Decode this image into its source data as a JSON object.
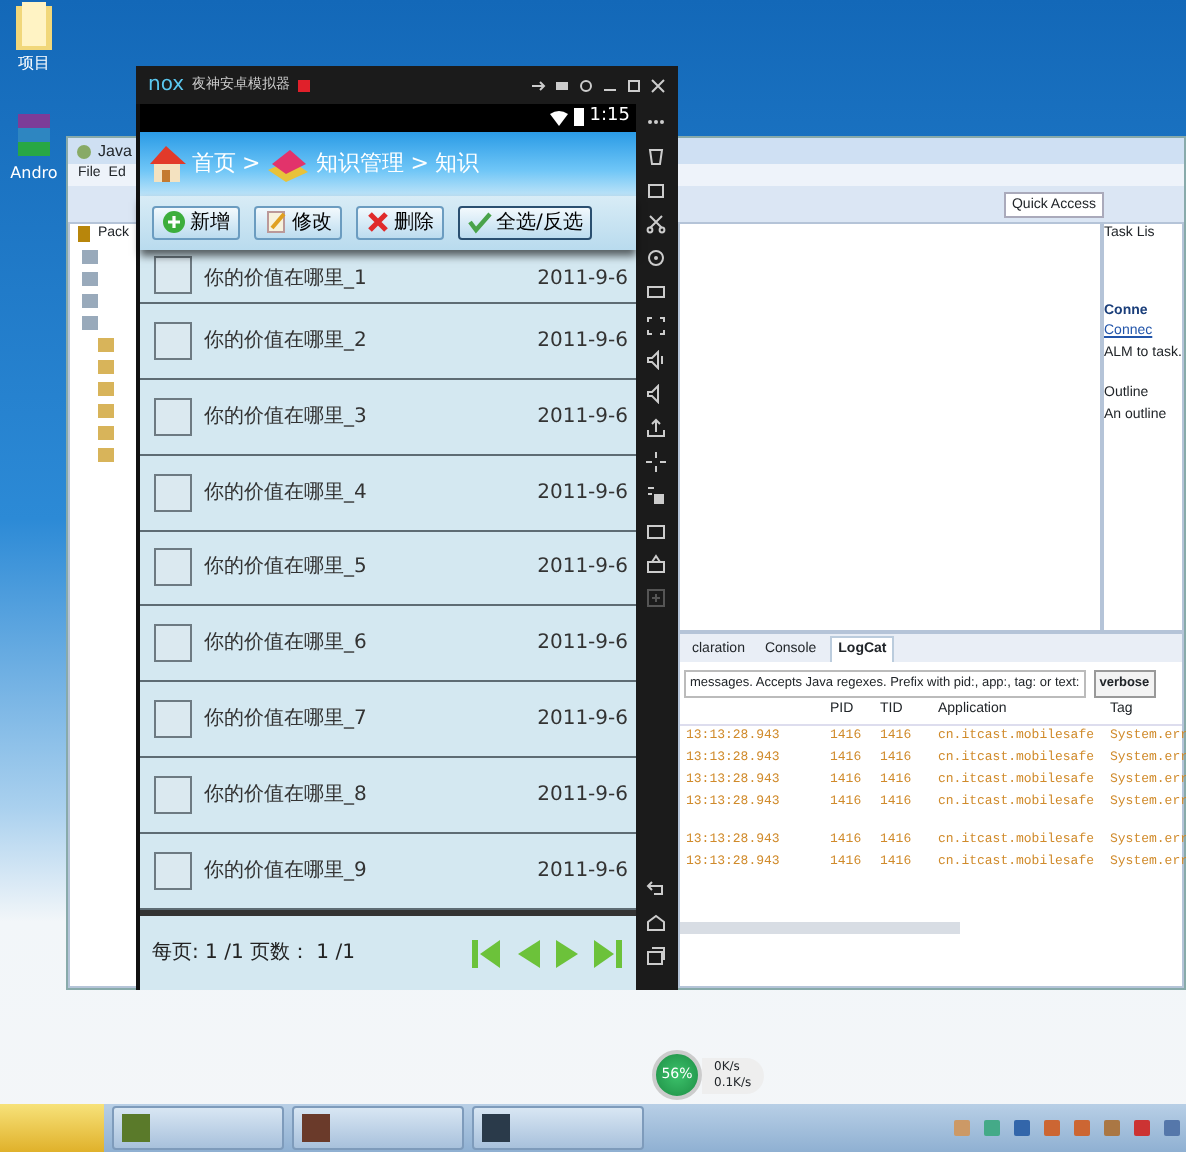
{
  "desktop": {
    "icons": [
      {
        "label": "项目"
      },
      {
        "label": "Andro"
      }
    ]
  },
  "eclipse": {
    "title": "Java",
    "menu": [
      "File",
      "Ed"
    ],
    "quick_access": "Quick Access",
    "package_explorer": "Pack",
    "task_list": {
      "title": "Task Lis",
      "heading": "Conne",
      "link": "Connec",
      "text": "ALM to task."
    },
    "outline": {
      "title": "Outline",
      "text": "An outline"
    },
    "tabs": [
      {
        "label": "claration",
        "selected": false
      },
      {
        "label": "Console",
        "selected": false
      },
      {
        "label": "LogCat",
        "selected": true
      }
    ],
    "filter": "messages. Accepts Java regexes. Prefix with pid:, app:, tag: or text:",
    "log_level": "verbose",
    "log": {
      "columns": [
        "PID",
        "TID",
        "Application",
        "Tag"
      ],
      "rows": [
        {
          "time": "13:13:28.943",
          "pid": "1416",
          "tid": "1416",
          "application": "cn.itcast.mobilesafe",
          "tag": "System.err"
        },
        {
          "time": "13:13:28.943",
          "pid": "1416",
          "tid": "1416",
          "application": "cn.itcast.mobilesafe",
          "tag": "System.err"
        },
        {
          "time": "13:13:28.943",
          "pid": "1416",
          "tid": "1416",
          "application": "cn.itcast.mobilesafe",
          "tag": "System.err"
        },
        {
          "time": "13:13:28.943",
          "pid": "1416",
          "tid": "1416",
          "application": "cn.itcast.mobilesafe",
          "tag": "System.err"
        },
        {
          "time": "13:13:28.943",
          "pid": "1416",
          "tid": "1416",
          "application": "cn.itcast.mobilesafe",
          "tag": "System.err"
        },
        {
          "time": "13:13:28.943",
          "pid": "1416",
          "tid": "1416",
          "application": "cn.itcast.mobilesafe",
          "tag": "System.err"
        }
      ]
    }
  },
  "emulator": {
    "logo": "nox",
    "title": "夜神安卓模拟器",
    "clock": "1:15",
    "breadcrumb": {
      "items": [
        "首页",
        "知识管理",
        "知识"
      ],
      "separator": ">"
    },
    "buttons": [
      {
        "label": "新增",
        "kind": "add"
      },
      {
        "label": "修改",
        "kind": "edit"
      },
      {
        "label": "删除",
        "kind": "delete"
      },
      {
        "label": "全选/反选",
        "kind": "select"
      }
    ],
    "list": [
      {
        "title": "你的价值在哪里_1",
        "date": "2011-9-6",
        "checked": false
      },
      {
        "title": "你的价值在哪里_2",
        "date": "2011-9-6",
        "checked": false
      },
      {
        "title": "你的价值在哪里_3",
        "date": "2011-9-6",
        "checked": false
      },
      {
        "title": "你的价值在哪里_4",
        "date": "2011-9-6",
        "checked": false
      },
      {
        "title": "你的价值在哪里_5",
        "date": "2011-9-6",
        "checked": false
      },
      {
        "title": "你的价值在哪里_6",
        "date": "2011-9-6",
        "checked": false
      },
      {
        "title": "你的价值在哪里_7",
        "date": "2011-9-6",
        "checked": false
      },
      {
        "title": "你的价值在哪里_8",
        "date": "2011-9-6",
        "checked": false
      },
      {
        "title": "你的价值在哪里_9",
        "date": "2011-9-6",
        "checked": false
      }
    ],
    "pager": "每页: 1 /1  页数：  1 /1"
  },
  "network_widget": {
    "usage": "56%",
    "upload": "0K/s",
    "download": "0.1K/s"
  }
}
